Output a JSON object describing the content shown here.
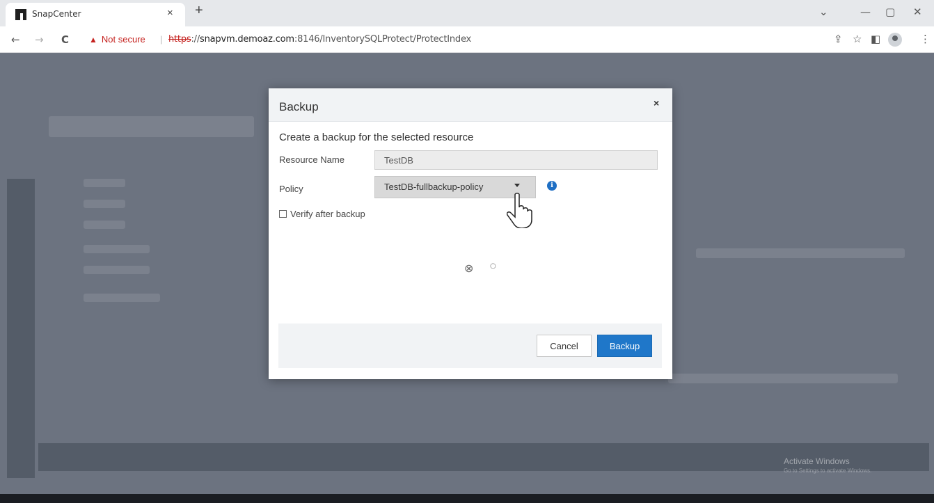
{
  "browser": {
    "tab_title": "SnapCenter",
    "tab_close": "×",
    "new_tab": "+",
    "security_label": "Not secure",
    "url_scheme": "https",
    "url_host": "snapvm.demoaz.com",
    "url_rest": ":8146/InventorySQLProtect/ProtectIndex",
    "url_sep": "://",
    "window_controls": {
      "menu": "⌄",
      "minimize": "—",
      "restore": "▢",
      "close": "✕"
    },
    "nav": {
      "back": "←",
      "forward": "→",
      "reload": "C"
    },
    "toolbar": {
      "share": "⇪",
      "star": "☆",
      "sidepanel": "◧",
      "menu": "⋮"
    }
  },
  "dialog": {
    "title": "Backup",
    "close": "×",
    "subtitle": "Create a backup for the selected resource",
    "resource_name_label": "Resource Name",
    "resource_name_value": "TestDB",
    "policy_label": "Policy",
    "policy_value": "TestDB-fullbackup-policy",
    "info_icon": "i",
    "verify_label": "Verify after backup",
    "verify_checked": false,
    "spinner_glyph": "⊗",
    "spinner_dot": "○",
    "cancel_label": "Cancel",
    "backup_label": "Backup"
  },
  "watermark": {
    "title": "Activate Windows",
    "subtitle": "Go to Settings to activate Windows."
  },
  "colors": {
    "primary_button": "#1f77c9",
    "info_icon": "#1f6fc4",
    "not_secure": "#c5221f"
  }
}
